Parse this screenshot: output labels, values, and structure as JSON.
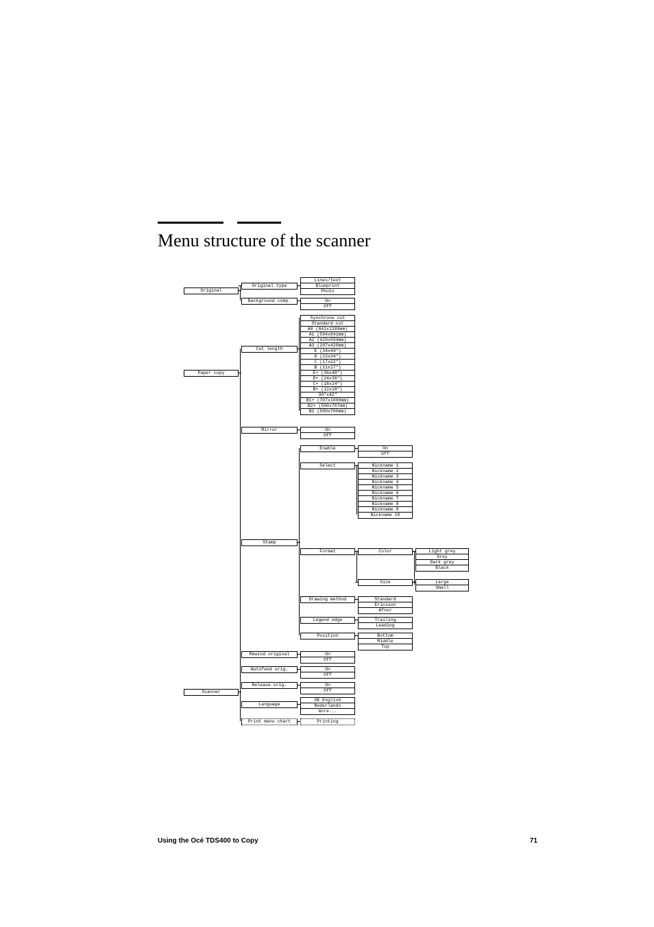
{
  "title": "Menu structure of the scanner",
  "footer": {
    "text": "Using the Océ TDS400 to Copy",
    "page": "71"
  },
  "col1": {
    "original": "Original",
    "paper_copy": "Paper copy",
    "scanner": "Scanner"
  },
  "col2": {
    "original_type": "Original type",
    "background_comp": "Background comp.",
    "cut_length": "Cut length",
    "mirror": "Mirror",
    "stamp": "Stamp",
    "rewind_original": "Rewind original",
    "autofeed_orig": "Autofeed orig.",
    "release_orig": "Release orig.",
    "language": "Language",
    "print_menu_chart": "Print menu chart"
  },
  "original_type_opts": {
    "lines_text": "Lines/text",
    "blueprint": "Blueprint",
    "photo": "Photo"
  },
  "bgcomp_opts": {
    "on": "On",
    "off": "Off"
  },
  "cut_opts": {
    "o0": "Synchrone cut",
    "o1": "Standard cut",
    "o2": "A0 (841x1189mm)",
    "o3": "A1 (594x841mm)",
    "o4": "A2 (420x594mm)",
    "o5": "A3 (297x420mm)",
    "o6": "E (34x44\")",
    "o7": "D (22x34\")",
    "o8": "C (17x22\")",
    "o9": "B (11x17\")",
    "o10": "E+ (36x48\")",
    "o11": "D+ (24x36\")",
    "o12": "C+ (18x24\")",
    "o13": "B+ (12x18\")",
    "o14": "30\"x42\"",
    "o15": "B1+ (707x1000mm)",
    "o16": "B2+ (500x707mm)",
    "o17": "B2 (500x700mm)"
  },
  "mirror_opts": {
    "on": "On",
    "off": "Off"
  },
  "stamp": {
    "enable": "Enable",
    "enable_opts": {
      "on": "On",
      "off": "Off"
    },
    "select": "Select",
    "nicknames": {
      "n1": "Nickname 1",
      "n2": "Nickname 2",
      "n3": "Nickname 3",
      "n4": "Nickname 4",
      "n5": "Nickname 5",
      "n6": "Nickname 6",
      "n7": "Nickname 7",
      "n8": "Nickname 8",
      "n9": "Nickname 9",
      "n10": "Nickname 10"
    },
    "format": "Format",
    "format_color": "Color",
    "colors": {
      "c1": "Light grey",
      "c2": "Grey",
      "c3": "Dark grey",
      "c4": "Black"
    },
    "format_size": "Size",
    "sizes": {
      "s1": "Large",
      "s2": "Small"
    },
    "drawing_method": "Drawing method",
    "dm_opts": {
      "d1": "Standard",
      "d2": "Ericsson",
      "d3": "Afnor"
    },
    "legend_edge": "Legend edge",
    "le_opts": {
      "l1": "Trailing",
      "l2": "Leading"
    },
    "position": "Position",
    "pos_opts": {
      "p1": "Bottom",
      "p2": "Middle",
      "p3": "Top"
    }
  },
  "rewind_opts": {
    "on": "On",
    "off": "Off"
  },
  "autofeed_opts": {
    "on": "On",
    "off": "Off"
  },
  "release_opts": {
    "on": "On",
    "off": "Off"
  },
  "language_opts": {
    "l1": "UK English",
    "l2": "Nederlands",
    "l3": "more..."
  },
  "print_menu_opts": {
    "p1": "Printing"
  }
}
